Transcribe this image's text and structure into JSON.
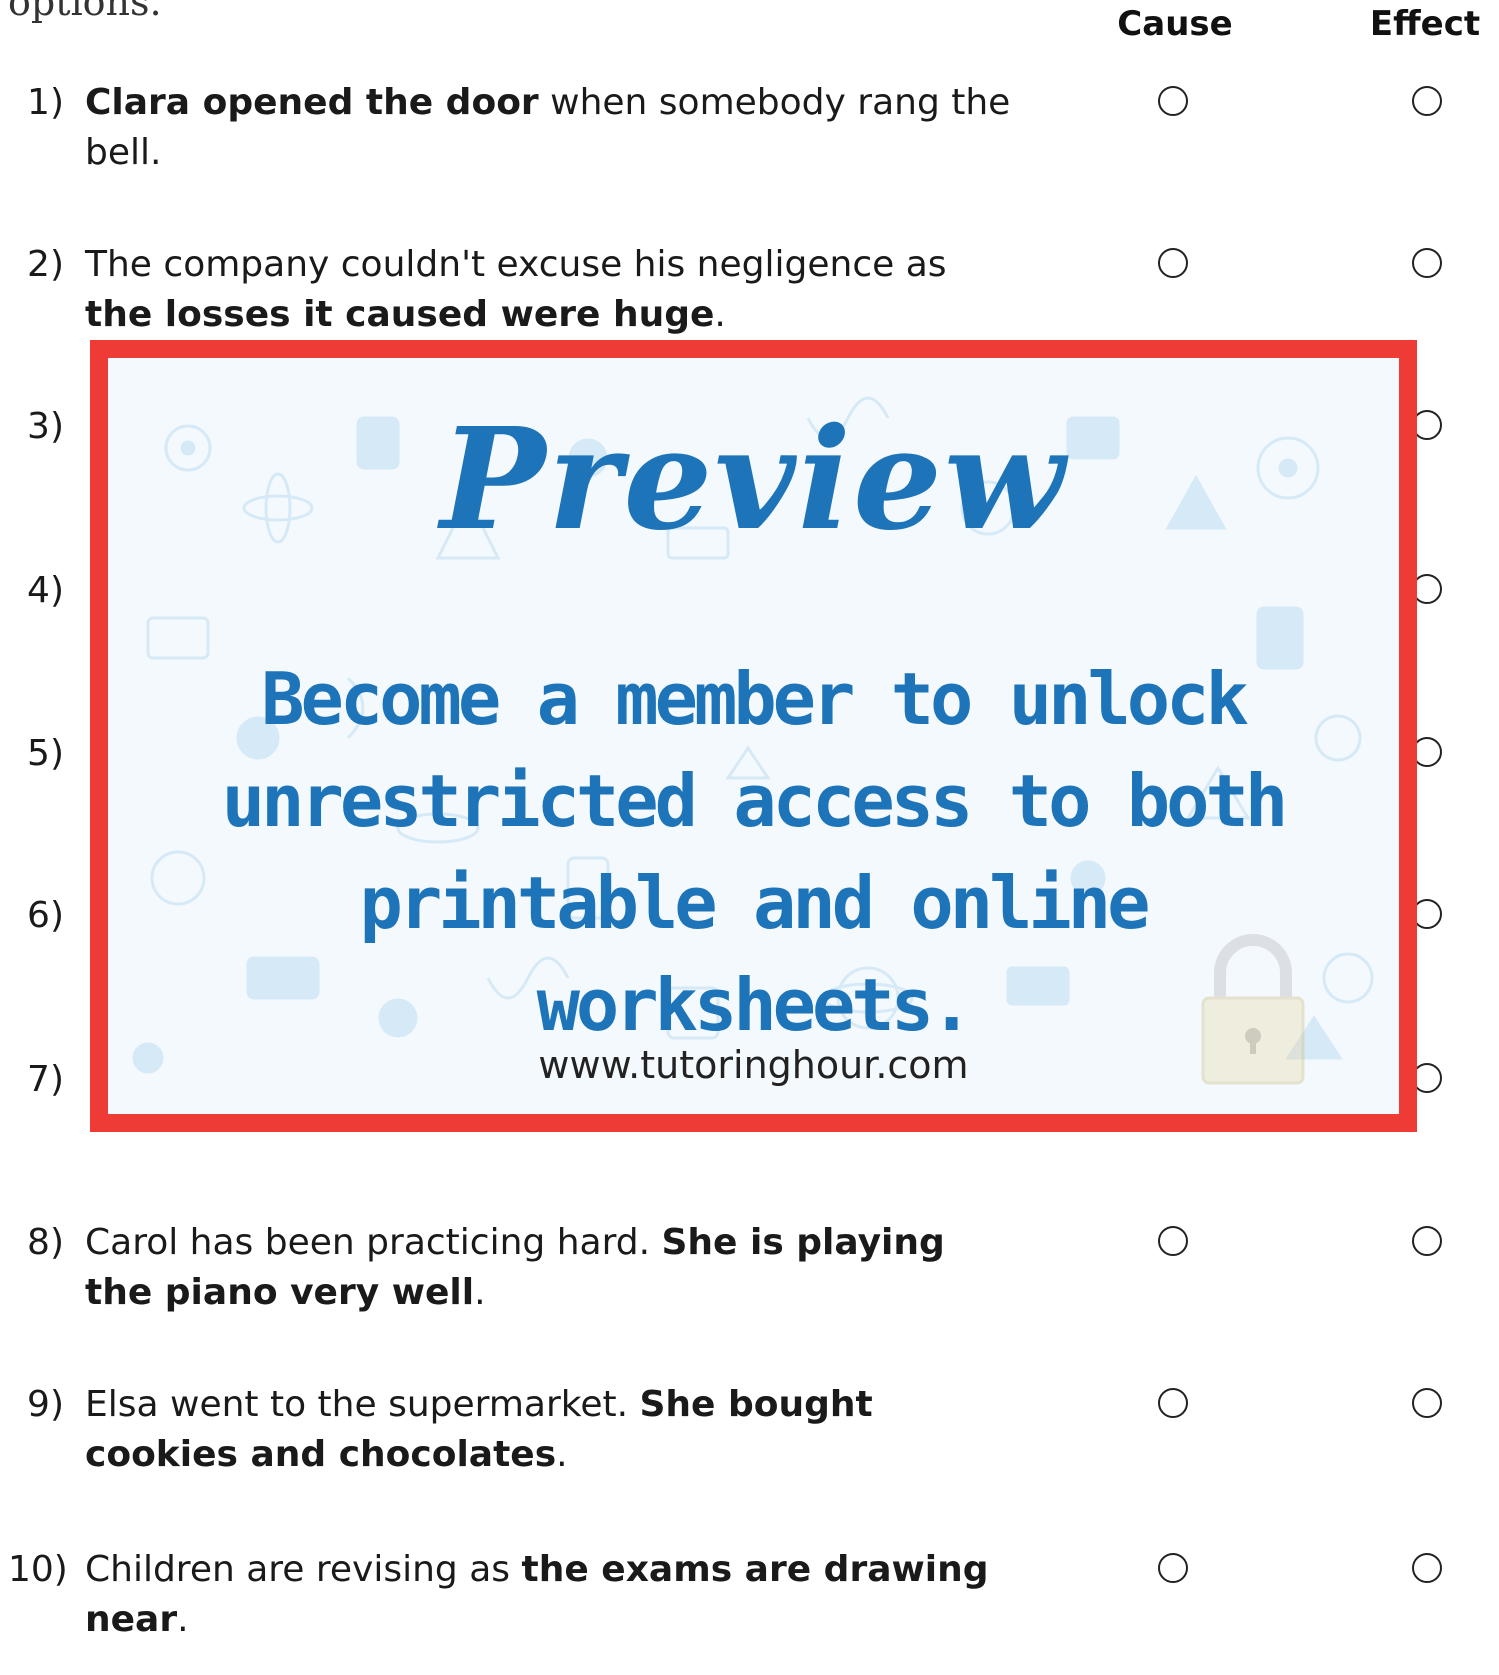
{
  "instructions_fragment": "options.",
  "columns": {
    "cause": "Cause",
    "effect": "Effect"
  },
  "questions": [
    {
      "num": "1)",
      "parts": [
        {
          "t": "Clara opened the door",
          "b": true
        },
        {
          "t": " when somebody rang the bell.",
          "b": false
        }
      ]
    },
    {
      "num": "2)",
      "parts": [
        {
          "t": "The company couldn't excuse his negligence as ",
          "b": false
        },
        {
          "t": "the losses it caused were huge",
          "b": true
        },
        {
          "t": ".",
          "b": false
        }
      ]
    },
    {
      "num": "3)",
      "parts": []
    },
    {
      "num": "4)",
      "parts": []
    },
    {
      "num": "5)",
      "parts": []
    },
    {
      "num": "6)",
      "parts": []
    },
    {
      "num": "7)",
      "parts": []
    },
    {
      "num": "8)",
      "parts": [
        {
          "t": "Carol has been practicing hard. ",
          "b": false
        },
        {
          "t": "She is playing the piano very well",
          "b": true
        },
        {
          "t": ".",
          "b": false
        }
      ]
    },
    {
      "num": "9)",
      "parts": [
        {
          "t": "Elsa went to the supermarket. ",
          "b": false
        },
        {
          "t": "She bought cookies and chocolates",
          "b": true
        },
        {
          "t": ".",
          "b": false
        }
      ]
    },
    {
      "num": "10)",
      "parts": [
        {
          "t": "Children are revising as ",
          "b": false
        },
        {
          "t": "the exams are drawing near",
          "b": true
        },
        {
          "t": ".",
          "b": false
        }
      ]
    }
  ],
  "preview": {
    "title": "Preview",
    "message": "Become a member to unlock unrestricted access to both printable and online worksheets.",
    "url": "www.tutoringhour.com",
    "border_color": "#ef3b36",
    "text_color": "#1e74b9",
    "lock_icon": "padlock-icon"
  }
}
